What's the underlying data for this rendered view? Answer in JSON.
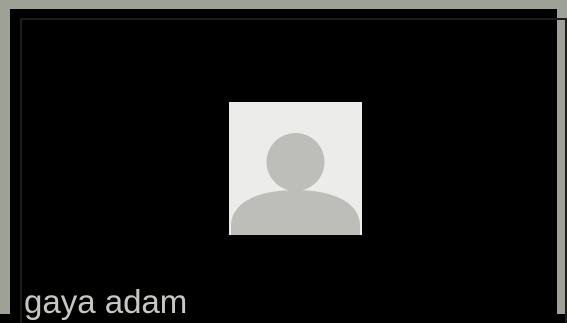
{
  "participant": {
    "name": "gaya adam",
    "avatar_icon": "default-user-silhouette-icon",
    "has_video": false
  },
  "colors": {
    "tile_background": "#000000",
    "tile_frame": "#9ea195",
    "avatar_background": "#ececea",
    "avatar_silhouette": "#bdbdba",
    "name_text": "#c7c7c3"
  }
}
